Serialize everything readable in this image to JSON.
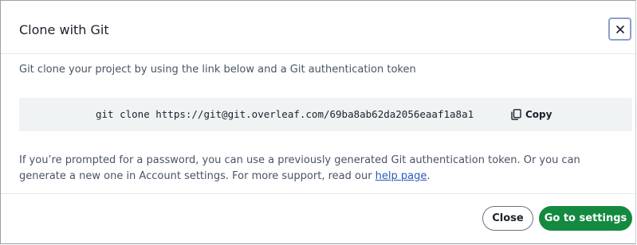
{
  "dialog": {
    "title": "Clone with Git",
    "close_icon": "close-icon"
  },
  "body": {
    "intro": "Git clone your project by using the link below and a Git authentication token",
    "clone_command": "git clone https://git@git.overleaf.com/69ba8ab62da2056eaaf1a8a1",
    "copy_label": "Copy",
    "copy_icon": "copy-icon",
    "help_text_before": "If you’re prompted for a password, you can use a previously generated Git authentication token. Or you can generate a new one in Account settings. For more support, read our ",
    "help_link": "help page",
    "help_text_after": "."
  },
  "footer": {
    "close_label": "Close",
    "settings_label": "Go to settings"
  },
  "colors": {
    "primary_green": "#138a3f",
    "link_blue": "#2a59bb",
    "code_bg": "#f0f3f4"
  }
}
